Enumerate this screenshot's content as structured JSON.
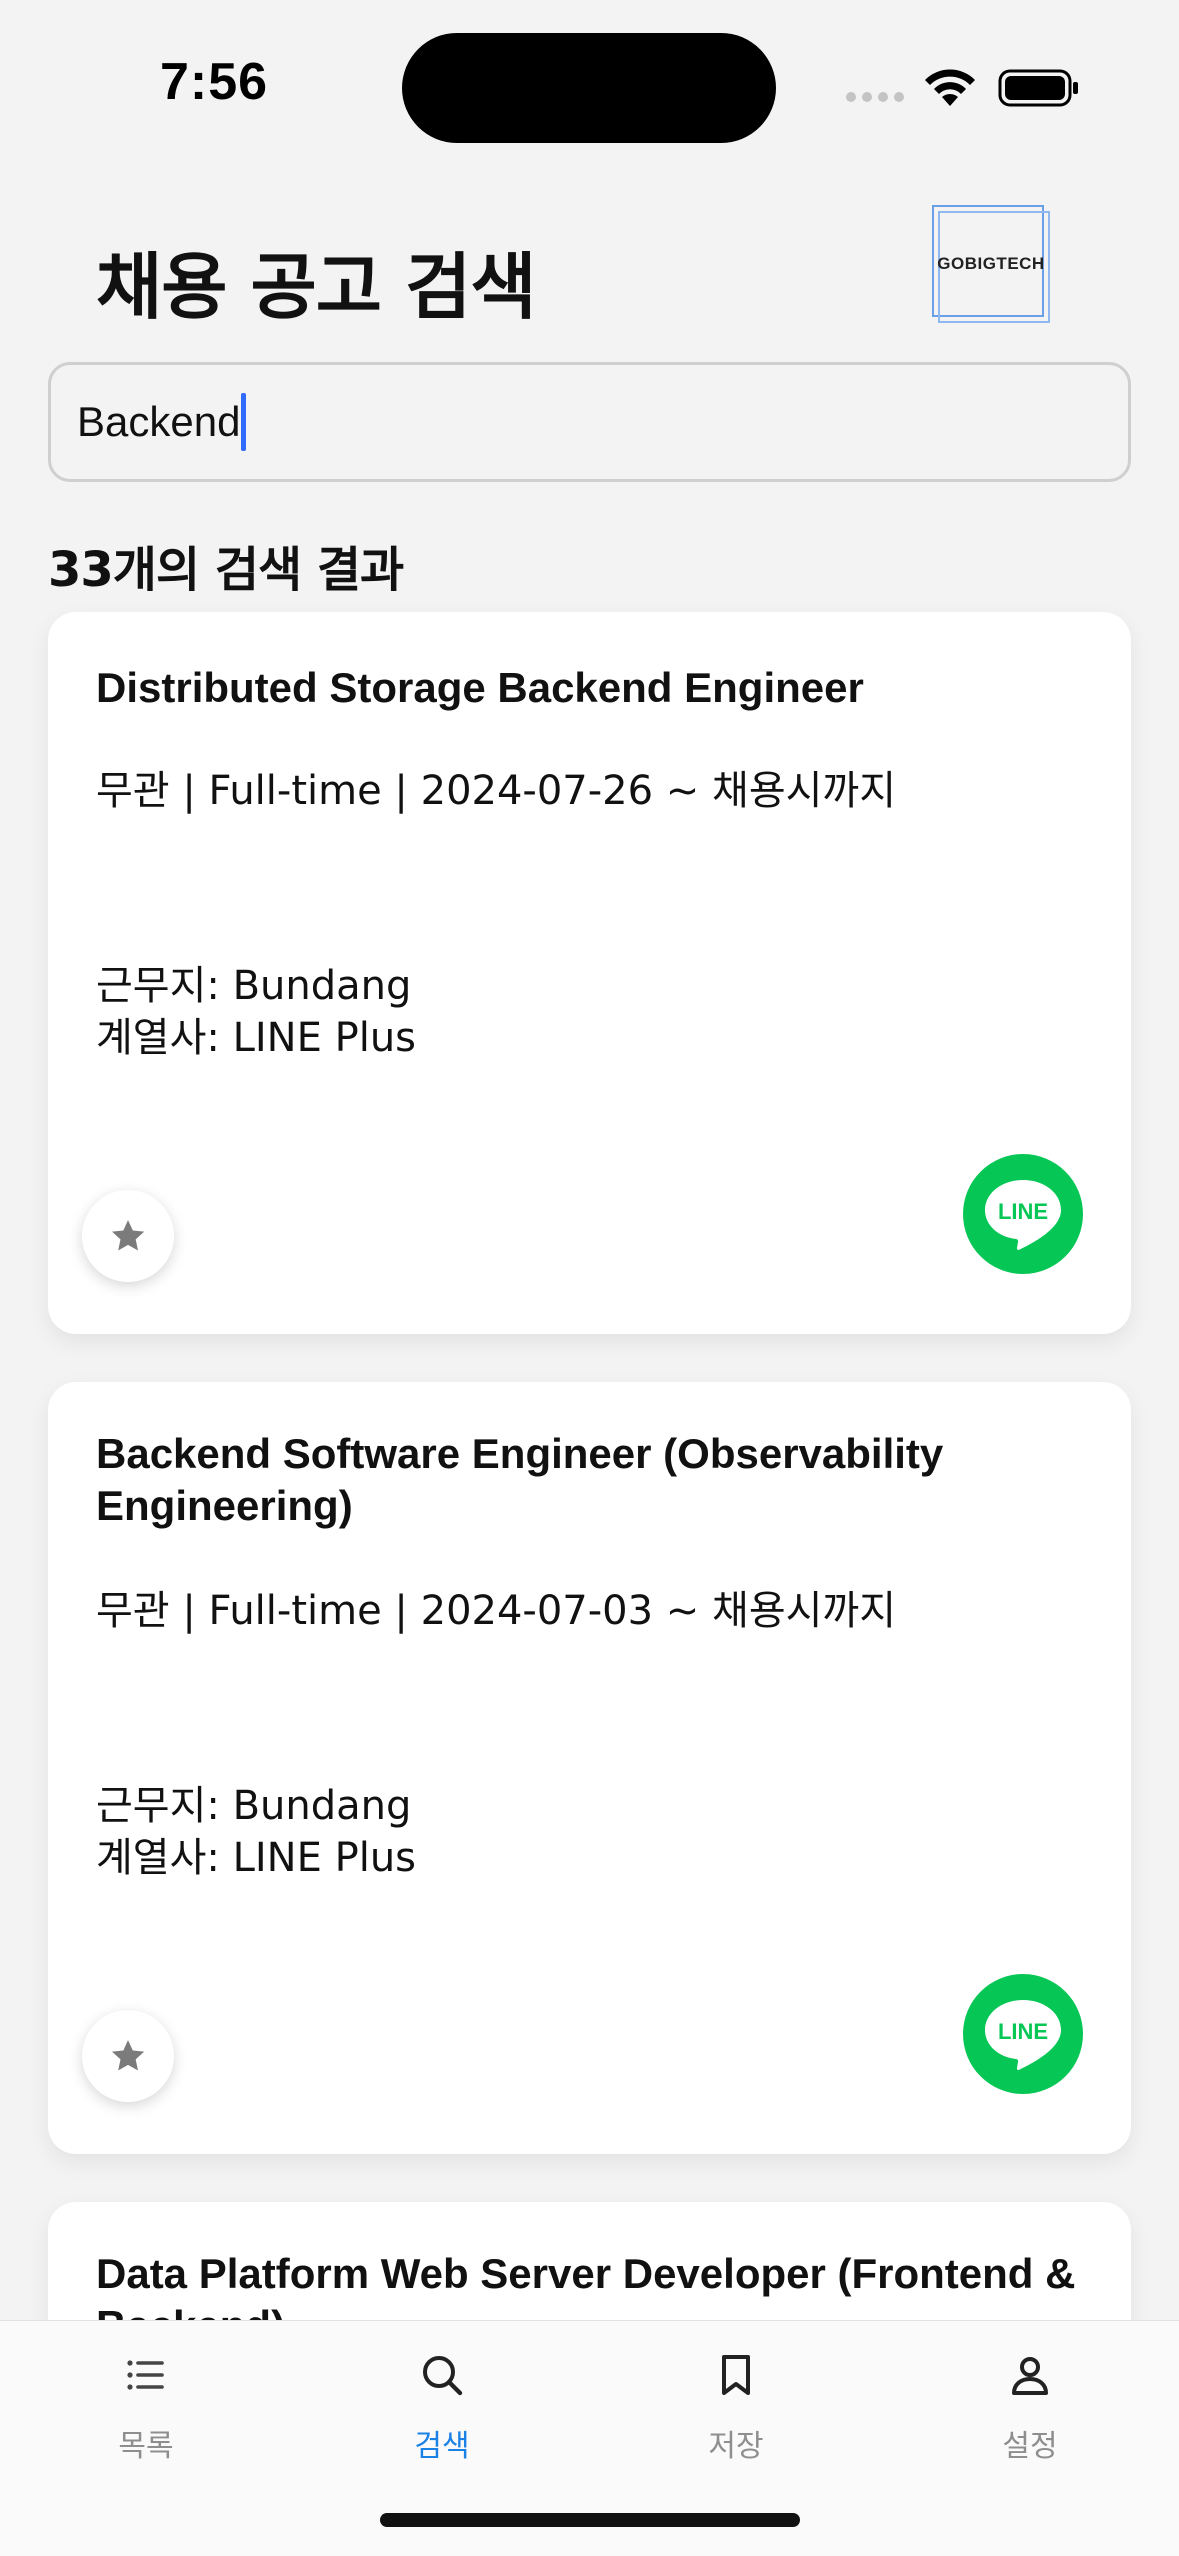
{
  "status_bar": {
    "time": "7:56"
  },
  "header": {
    "title": "채용 공고 검색",
    "logo_text": "GOBIGTECH"
  },
  "search": {
    "value": "Backend",
    "placeholder": ""
  },
  "results": {
    "count_label": "33개의 검색 결과",
    "items": [
      {
        "title": "Distributed Storage Backend Engineer",
        "meta": "무관 | Full-time | 2024-07-26 ~ 채용시까지",
        "location": "근무지: Bundang",
        "affiliate": "계열사: LINE Plus",
        "company_logo_text": "LINE"
      },
      {
        "title": "Backend Software Engineer (Observability Engineering)",
        "meta": "무관 | Full-time | 2024-07-03 ~ 채용시까지",
        "location": "근무지: Bundang",
        "affiliate": "계열사: LINE Plus",
        "company_logo_text": "LINE"
      },
      {
        "title": "Data Platform Web Server Developer (Frontend & Backend)"
      }
    ]
  },
  "tabbar": {
    "tabs": [
      {
        "label": "목록",
        "icon": "list-icon"
      },
      {
        "label": "검색",
        "icon": "search-icon"
      },
      {
        "label": "저장",
        "icon": "bookmark-icon"
      },
      {
        "label": "설정",
        "icon": "person-icon"
      }
    ],
    "active_index": 1
  },
  "colors": {
    "accent": "#1a82e6",
    "line_green": "#06c755",
    "caret": "#2f6bff"
  }
}
